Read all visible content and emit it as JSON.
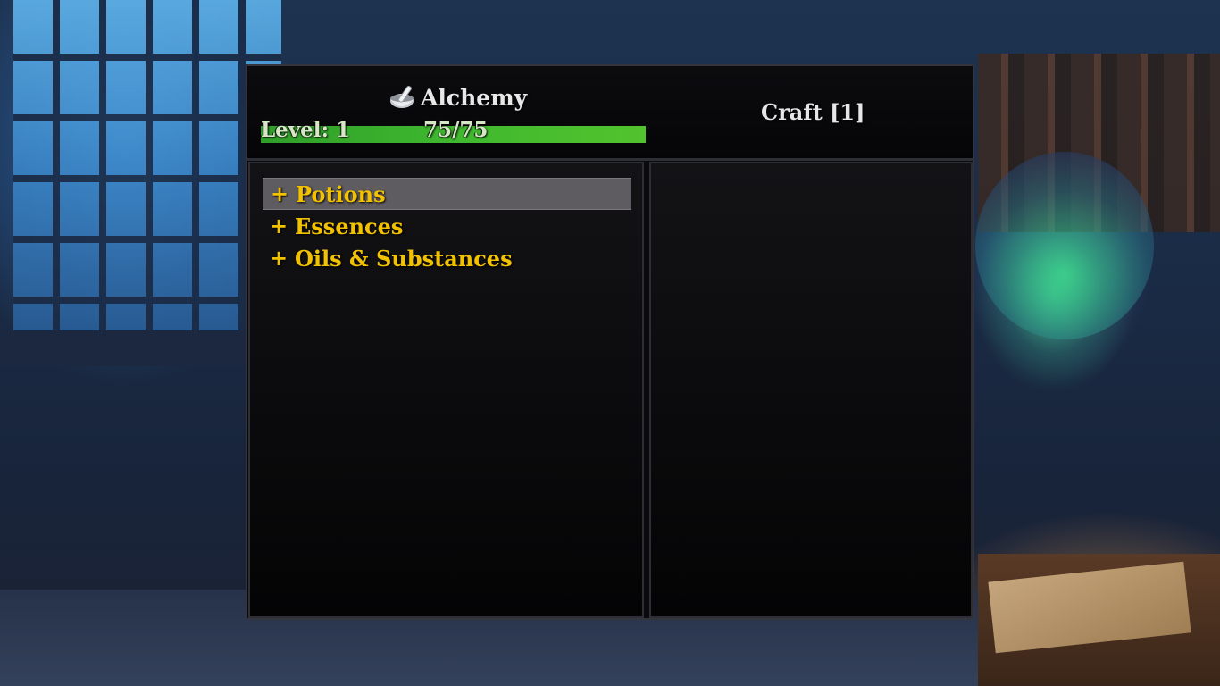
{
  "header": {
    "title": "Alchemy",
    "icon": "mortar-and-pestle-icon",
    "level_label": "Level: 1",
    "xp_text": "75/75",
    "xp_fill_fraction": 1.0,
    "craft_label": "Craft [1]"
  },
  "categories": [
    {
      "prefix": "+",
      "label": "Potions",
      "selected": true
    },
    {
      "prefix": "+",
      "label": "Essences",
      "selected": false
    },
    {
      "prefix": "+",
      "label": "Oils & Substances",
      "selected": false
    }
  ],
  "colors": {
    "category_text": "#f2c200",
    "xp_bar": "#3fb82f",
    "selected_row": "#5e5c60",
    "panel_bg": "#0a0a0c"
  }
}
